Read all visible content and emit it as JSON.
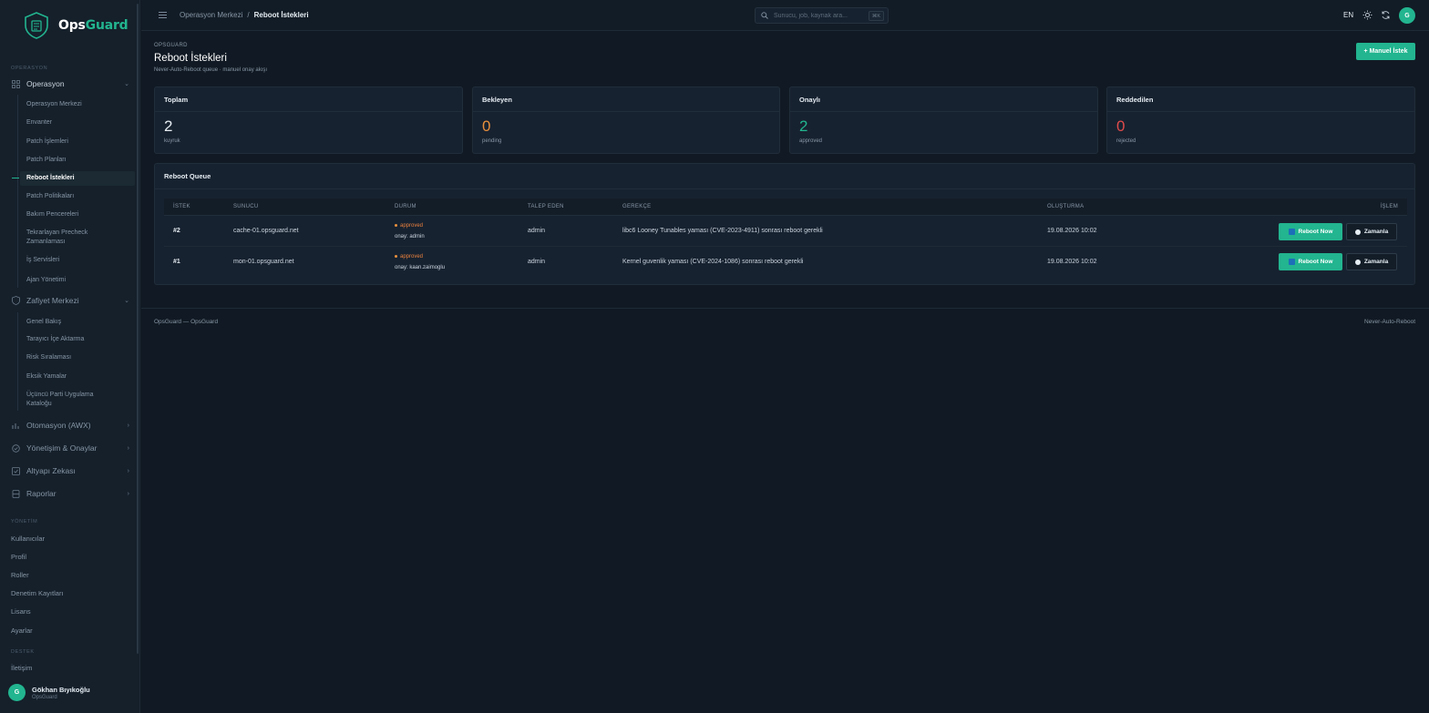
{
  "brand": {
    "name_a": "Ops",
    "name_b": "Guard"
  },
  "sidebar": {
    "section_operasyon": "OPERASYON",
    "groups": {
      "operasyon": "Operasyon",
      "zafiyet": "Zafiyet Merkezi",
      "otomasyon": "Otomasyon (AWX)",
      "yonetisim": "Yönetişim & Onaylar",
      "altyapi": "Altyapı Zekası",
      "raporlar": "Raporlar"
    },
    "operasyon_items": [
      "Operasyon Merkezi",
      "Envanter",
      "Patch İşlemleri",
      "Patch Planları",
      "Reboot İstekleri",
      "Patch Politikaları",
      "Bakım Pencereleri",
      "Tekrarlayan Precheck Zamanlaması",
      "İş Servisleri",
      "Ajan Yönetimi"
    ],
    "zafiyet_items": [
      "Genel Bakış",
      "Tarayıcı İçe Aktarma",
      "Risk Sıralaması",
      "Eksik Yamalar",
      "Üçüncü Parti Uygulama Kataloğu"
    ],
    "section_yonetim": "YÖNETİM",
    "yonetim_items": [
      "Kullanıcılar",
      "Profil",
      "Roller",
      "Denetim Kayıtları",
      "Lisans",
      "Ayarlar"
    ],
    "section_destek": "DESTEK",
    "destek_items": [
      "İletişim"
    ],
    "user": {
      "initial": "G",
      "name": "Gökhan Bıyıkoğlu",
      "org": "OpsGuard"
    }
  },
  "topbar": {
    "breadcrumb_parent": "Operasyon Merkezi",
    "breadcrumb_sep": "/",
    "breadcrumb_current": "Reboot İstekleri",
    "search_placeholder": "Sunucu, job, kaynak ara...",
    "search_shortcut": "⌘K",
    "lang": "EN",
    "avatar_initial": "G"
  },
  "page": {
    "eyebrow": "OPSGUARD",
    "title": "Reboot İstekleri",
    "subtitle": "Never-Auto-Reboot queue · manuel onay akışı",
    "primary_button": "+ Manuel İstek"
  },
  "stats": [
    {
      "label": "Toplam",
      "value": "2",
      "caption": "kuyruk",
      "color": "#e6edf3"
    },
    {
      "label": "Bekleyen",
      "value": "0",
      "caption": "pending",
      "color": "#e8903d"
    },
    {
      "label": "Onaylı",
      "value": "2",
      "caption": "approved",
      "color": "#22b58f"
    },
    {
      "label": "Reddedilen",
      "value": "0",
      "caption": "rejected",
      "color": "#e04b4b"
    }
  ],
  "queue": {
    "title": "Reboot Queue",
    "columns": [
      "İSTEK",
      "SUNUCU",
      "DURUM",
      "TALEP EDEN",
      "GEREKÇE",
      "OLUŞTURMA",
      "İŞLEM"
    ],
    "rows": [
      {
        "id": "#2",
        "server": "cache-01.opsguard.net",
        "status": "approved",
        "onay": "onay: admin",
        "requester": "admin",
        "reason": "libc6 Looney Tunables yaması (CVE-2023-4911) sonrası reboot gerekli",
        "created": "19.08.2026 10:02",
        "reboot_label": "Reboot Now",
        "schedule_label": "Zamanla"
      },
      {
        "id": "#1",
        "server": "mon-01.opsguard.net",
        "status": "approved",
        "onay": "onay: kaan.zaimoglu",
        "requester": "admin",
        "reason": "Kernel guvenlik yaması (CVE-2024-1086) sonrası reboot gerekli",
        "created": "19.08.2026 10:02",
        "reboot_label": "Reboot Now",
        "schedule_label": "Zamanla"
      }
    ]
  },
  "footer": {
    "left": "OpsGuard — OpsGuard",
    "right": "Never-Auto-Reboot"
  },
  "colors": {
    "accent": "#22b58f",
    "warning": "#e8903d",
    "danger": "#e04b4b",
    "background": "#111a24"
  }
}
